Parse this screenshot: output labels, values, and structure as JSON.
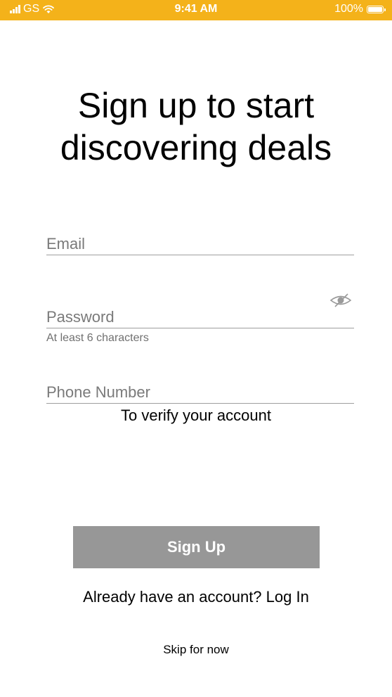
{
  "status_bar": {
    "carrier": "GS",
    "time": "9:41 AM",
    "battery": "100%"
  },
  "title_line1": "Sign up to start",
  "title_line2": "discovering deals",
  "form": {
    "email_placeholder": "Email",
    "password_placeholder": "Password",
    "password_hint": "At least 6 characters",
    "phone_placeholder": "Phone Number",
    "phone_hint": "To verify your account",
    "password_toggle_icon": "eye-hidden-icon"
  },
  "signup_button": "Sign Up",
  "login_prompt": "Already have an account?",
  "login_link": "Log In",
  "skip_link": "Skip for now",
  "colors": {
    "status_bar": "#F4B21A",
    "button": "#979797",
    "field_underline": "#9e9e9e",
    "placeholder": "#7a7a7a"
  }
}
